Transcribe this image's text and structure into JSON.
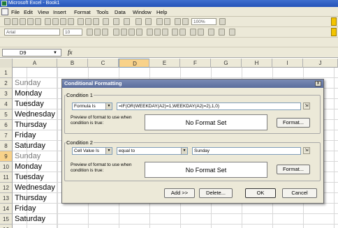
{
  "window": {
    "title": "Microsoft Excel - Book1"
  },
  "menu": [
    "File",
    "Edit",
    "View",
    "Insert",
    "Format",
    "Tools",
    "Data",
    "Window",
    "Help"
  ],
  "toolbar": {
    "zoom": "100%",
    "font": "Arial",
    "size": "10"
  },
  "formula_bar": {
    "name_box": "D9",
    "fx": "fx"
  },
  "columns": [
    "A",
    "B",
    "C",
    "D",
    "E",
    "F",
    "G",
    "H",
    "I",
    "J"
  ],
  "rows": [
    "1",
    "2",
    "3",
    "4",
    "5",
    "6",
    "7",
    "8",
    "9",
    "10",
    "11",
    "12",
    "13",
    "14",
    "15",
    "16"
  ],
  "cells_a": [
    "",
    "Sunday",
    "Monday",
    "Tuesday",
    "Wednesday",
    "Thursday",
    "Friday",
    "Saturday",
    "Sunday",
    "Monday",
    "Tuesday",
    "Wednesday",
    "Thursday",
    "Friday",
    "Saturday",
    ""
  ],
  "dialog": {
    "title": "Conditional Formatting",
    "close": "x",
    "condition1": {
      "label": "Condition 1",
      "type": "Formula Is",
      "formula": "=IF(OR(WEEKDAY(A2)=1,WEEKDAY(A2)=2),1,0)",
      "preview_label": "Preview of format to use when condition is true:",
      "preview": "No Format Set",
      "format_button": "Format..."
    },
    "condition2": {
      "label": "Condition 2",
      "type": "Cell Value Is",
      "operator": "equal to",
      "value": "Sunday",
      "preview_label": "Preview of format to use when condition is true:",
      "preview": "No Format Set",
      "format_button": "Format..."
    },
    "buttons": {
      "add": "Add >>",
      "delete": "Delete...",
      "ok": "OK",
      "cancel": "Cancel"
    }
  }
}
